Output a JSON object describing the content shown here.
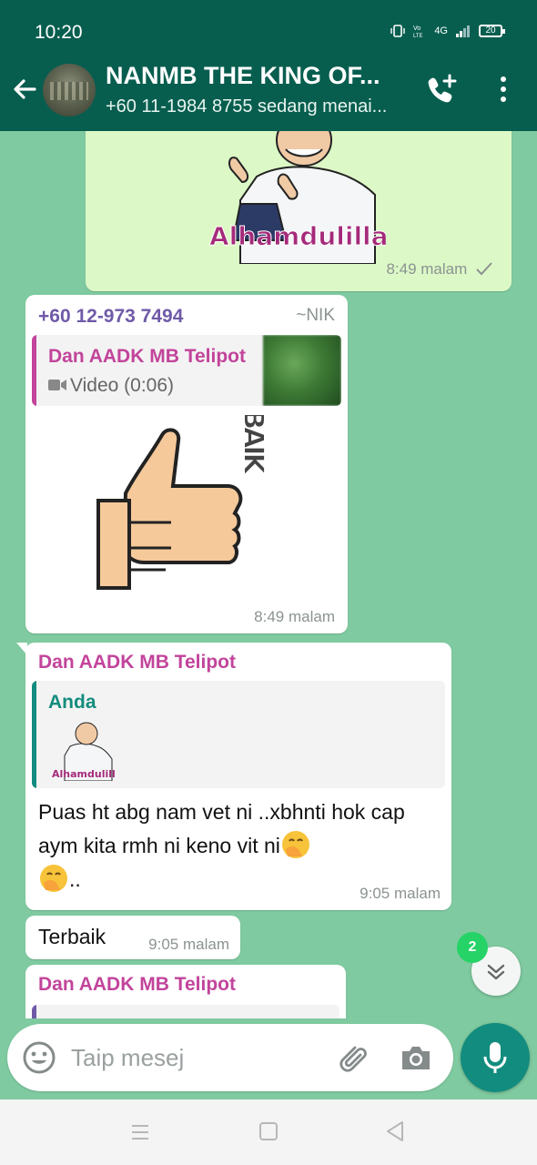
{
  "status_bar": {
    "time": "10:20",
    "network": "4G",
    "battery": "20"
  },
  "header": {
    "title": "NANMB THE KING OF...",
    "subtitle": "+60 11-1984 8755 sedang menai..."
  },
  "messages": [
    {
      "type": "sticker",
      "direction": "outgoing",
      "sticker_caption": "Alhamdulillah",
      "time": "8:49 malam"
    },
    {
      "type": "sticker",
      "direction": "incoming",
      "sender": "+60 12-973 7494",
      "alias": "~NIK",
      "quote": {
        "name": "Dan AADK MB Telipot",
        "text": "Video (0:06)"
      },
      "sticker_caption": "TERBAIK",
      "time": "8:49 malam"
    },
    {
      "type": "text",
      "direction": "incoming",
      "sender": "Dan AADK MB Telipot",
      "quote": {
        "name": "Anda",
        "sticker_caption": "Alhamdulillah"
      },
      "text_part1": "Puas ht abg nam vet ni ..xbhnti hok cap aym kita rmh ni keno vit ni",
      "text_part2": "..",
      "time": "9:05 malam"
    },
    {
      "type": "text",
      "direction": "incoming",
      "text": "Terbaik",
      "time": "9:05 malam"
    },
    {
      "type": "text",
      "direction": "incoming",
      "sender": "Dan AADK MB Telipot"
    }
  ],
  "scroll": {
    "unread_count": "2"
  },
  "composer": {
    "placeholder": "Taip mesej"
  },
  "colors": {
    "header": "#075e4f",
    "chat_background": "#7fcaa0",
    "outgoing_bubble": "#dcf8c6",
    "accent": "#128c7e",
    "sender_pink": "#c2449b",
    "sender_purple": "#6f5aa8"
  }
}
